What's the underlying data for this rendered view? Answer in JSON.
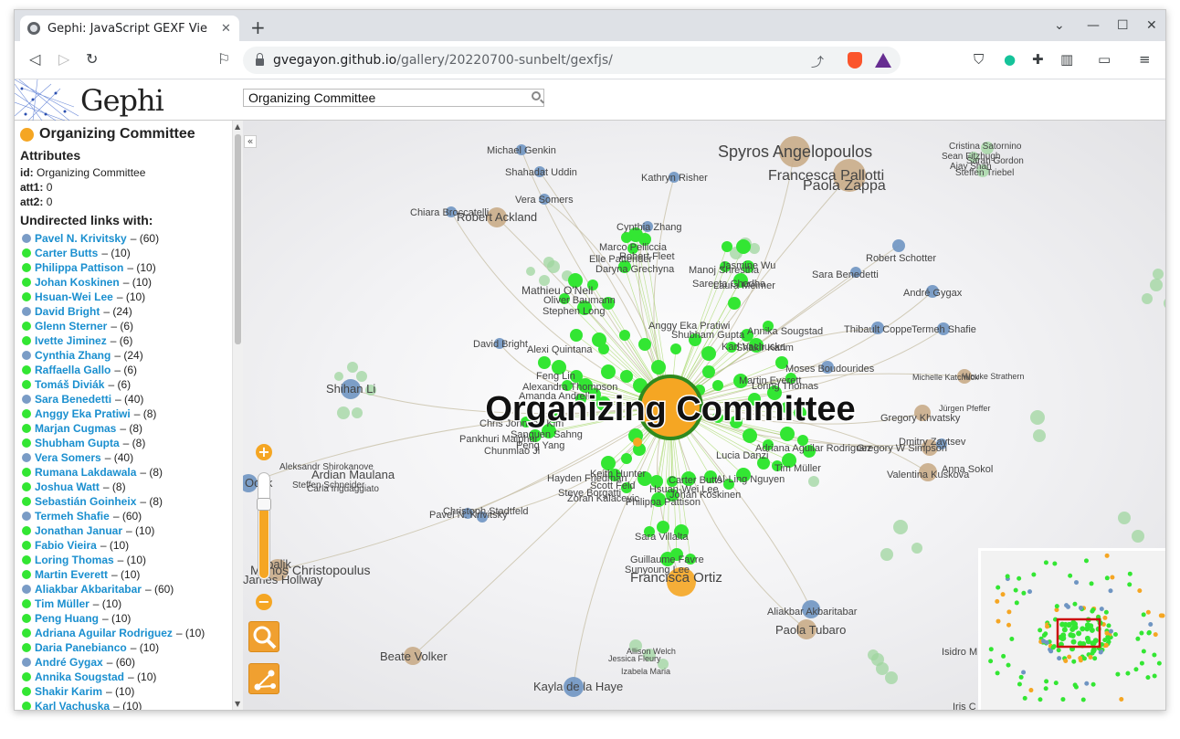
{
  "browser": {
    "tab_title": "Gephi: JavaScript GEXF Vie",
    "url_host": "gvegayon.github.io",
    "url_path": "/gallery/20220700-sunbelt/gexfjs/"
  },
  "header": {
    "logo_text": "Gephi",
    "search_value": "Organizing Committee"
  },
  "sidebar": {
    "node_title": "Organizing Committee",
    "node_color": "#f5a623",
    "attributes_title": "Attributes",
    "attrs": [
      {
        "key": "id:",
        "value": "Organizing Committee"
      },
      {
        "key": "att1:",
        "value": "0"
      },
      {
        "key": "att2:",
        "value": "0"
      }
    ],
    "links_title": "Undirected links with:",
    "links": [
      {
        "name": "Pavel N. Krivitsky",
        "weight": "– (60)",
        "color": "#7a9cc6"
      },
      {
        "name": "Carter Butts",
        "weight": "– (10)",
        "color": "#33e633"
      },
      {
        "name": "Philippa Pattison",
        "weight": "– (10)",
        "color": "#33e633"
      },
      {
        "name": "Johan Koskinen",
        "weight": "– (10)",
        "color": "#33e633"
      },
      {
        "name": "Hsuan-Wei Lee",
        "weight": "– (10)",
        "color": "#33e633"
      },
      {
        "name": "David Bright",
        "weight": "– (24)",
        "color": "#7a9cc6"
      },
      {
        "name": "Glenn Sterner",
        "weight": "– (6)",
        "color": "#33e633"
      },
      {
        "name": "Ivette Jiminez",
        "weight": "– (6)",
        "color": "#33e633"
      },
      {
        "name": "Cynthia Zhang",
        "weight": "– (24)",
        "color": "#7a9cc6"
      },
      {
        "name": "Raffaella Gallo",
        "weight": "– (6)",
        "color": "#33e633"
      },
      {
        "name": "Tomáš Diviák",
        "weight": "– (6)",
        "color": "#33e633"
      },
      {
        "name": "Sara Benedetti",
        "weight": "– (40)",
        "color": "#7a9cc6"
      },
      {
        "name": "Anggy Eka Pratiwi",
        "weight": "– (8)",
        "color": "#33e633"
      },
      {
        "name": "Marjan Cugmas",
        "weight": "– (8)",
        "color": "#33e633"
      },
      {
        "name": "Shubham Gupta",
        "weight": "– (8)",
        "color": "#33e633"
      },
      {
        "name": "Vera Somers",
        "weight": "– (40)",
        "color": "#7a9cc6"
      },
      {
        "name": "Rumana Lakdawala",
        "weight": "– (8)",
        "color": "#33e633"
      },
      {
        "name": "Joshua Watt",
        "weight": "– (8)",
        "color": "#33e633"
      },
      {
        "name": "Sebastián Goinheix",
        "weight": "– (8)",
        "color": "#33e633"
      },
      {
        "name": "Termeh Shafie",
        "weight": "– (60)",
        "color": "#7a9cc6"
      },
      {
        "name": "Jonathan Januar",
        "weight": "– (10)",
        "color": "#33e633"
      },
      {
        "name": "Fabio Vieira",
        "weight": "– (10)",
        "color": "#33e633"
      },
      {
        "name": "Loring Thomas",
        "weight": "– (10)",
        "color": "#33e633"
      },
      {
        "name": "Martin Everett",
        "weight": "– (10)",
        "color": "#33e633"
      },
      {
        "name": "Aliakbar Akbaritabar",
        "weight": "– (60)",
        "color": "#7a9cc6"
      },
      {
        "name": "Tim Müller",
        "weight": "– (10)",
        "color": "#33e633"
      },
      {
        "name": "Peng Huang",
        "weight": "– (10)",
        "color": "#33e633"
      },
      {
        "name": "Adriana Aguilar Rodriguez",
        "weight": "– (10)",
        "color": "#33e633"
      },
      {
        "name": "Daria Panebianco",
        "weight": "– (10)",
        "color": "#33e633"
      },
      {
        "name": "André Gygax",
        "weight": "– (60)",
        "color": "#7a9cc6"
      },
      {
        "name": "Annika Sougstad",
        "weight": "– (10)",
        "color": "#33e633"
      },
      {
        "name": "Shakir Karim",
        "weight": "– (10)",
        "color": "#33e633"
      },
      {
        "name": "Karl Vachuska",
        "weight": "– (10)",
        "color": "#33e633"
      }
    ]
  },
  "graph": {
    "center_label": "Organizing Committee",
    "labels": {
      "spyros": "Spyros Angelopoulos",
      "francesca": "Francesca Pallotti",
      "paola_z": "Paola Zappa",
      "michael": "Michael Genkin",
      "shahadat": "Shahadat Uddin",
      "kathryn": "Kathryn Risher",
      "vera": "Vera Somers",
      "chiara": "Chiara Broccatelli",
      "robert_a": "Robert Ackland",
      "cynthia": "Cynthia Zhang",
      "marco": "Marco Pelliccia",
      "elle": "Elle Pattender",
      "robert_f": "Robert Fleet",
      "daryna": "Daryna Grechyna",
      "jasmine": "Jasmine Wu",
      "manoj": "Manoj Shrestha",
      "sareeta": "Sareeta Chadha",
      "laura": "Laura Meimer",
      "robert_s": "Robert Schotter",
      "sara_b": "Sara Benedetti",
      "andre": "André Gygax",
      "mathieu": "Mathieu O'Neil",
      "oliver": "Oliver Baumann",
      "stephen": "Stephen Long",
      "thibault": "Thibault Coppe",
      "termeh": "Termeh Shafie",
      "david": "David Bright",
      "alexi": "Alexi Quintana",
      "anggy": "Anggy Eka Pratiwi",
      "shubham": "Shubham Gupta",
      "karl": "Karl Vachuska",
      "shakir": "Shakir Karim",
      "annika": "Annika Sougstad",
      "moses": "Moses Boudourides",
      "shihan": "Shihan Li",
      "feng": "Feng Lin",
      "alexandra": "Alexandra Thompson",
      "amanda": "Amanda Andrell",
      "martin": "Martin Everett",
      "loring": "Loring Thomas",
      "michelle": "Michelle Katchuck",
      "wouke": "Wouke Strathern",
      "jurgen": "Jürgen Pfeffer",
      "gregory_k": "Gregory Khvatsky",
      "dmitry": "Dmitry Zaytsev",
      "gregory_s": "Gregory W Simpson",
      "chris": "Chris Johnson Kim",
      "sanguen": "Sanguen Sahng",
      "pankhuri": "Pankhuri Maiphur",
      "peng": "Peng Yang",
      "chunmiao": "Chunmiao Ji",
      "ardian": "Ardian Maulana",
      "aleksandr": "Aleksandr Shirokanove",
      "steffen": "Steffen Schneider",
      "carla": "Carla Inguaggiato",
      "valentina": "Valentina Kuskova",
      "anna": "Anna Sokol",
      "keith": "Keith Hunter",
      "hayden": "Hayden Friedman",
      "scott": "Scott Feld",
      "steve": "Steve Borgatti",
      "zoran": "Zoran Kalacevic",
      "carter": "Carter Butts",
      "hsuan": "Hsuan-Wei Lee",
      "johan": "Johan Koskinen",
      "philippa": "Philippa Pattison",
      "christoph": "Christoph Stadtfeld",
      "pavel": "Pavel N. Krivitsky",
      "lucia": "Lucia Danzi",
      "tim": "Tim Müller",
      "al_ling": "Al-Ling Nguyen",
      "adriana": "Adriana Aguilar Rodriguez",
      "sara_v": "Sara Villalta",
      "guillaume": "Guillaume Favre",
      "sunyoung": "Sunyoung Lee",
      "francisca": "Francisca Ortiz",
      "manos": "Manos Christopoulus",
      "james": "James Hollway",
      "aliakbar": "Aliakbar Akbaritabar",
      "paola_t": "Paola Tubaro",
      "beate": "Beate Volker",
      "kayla": "Kayla de la Haye",
      "allison": "Allison Welch",
      "jessica": "Jessica Fleury",
      "izabela": "Izabela Maria",
      "isidro": "Isidro M",
      "iris": "Iris C",
      "cristina": "Cristina Satornino",
      "sean": "Sean Fitzhugh",
      "sarah": "Sarah Gordon",
      "ajay": "Ajay Shah",
      "steffen_t": "Steffen Triebel",
      "obalik": "Obalik",
      "ocak": "Ocak"
    }
  }
}
